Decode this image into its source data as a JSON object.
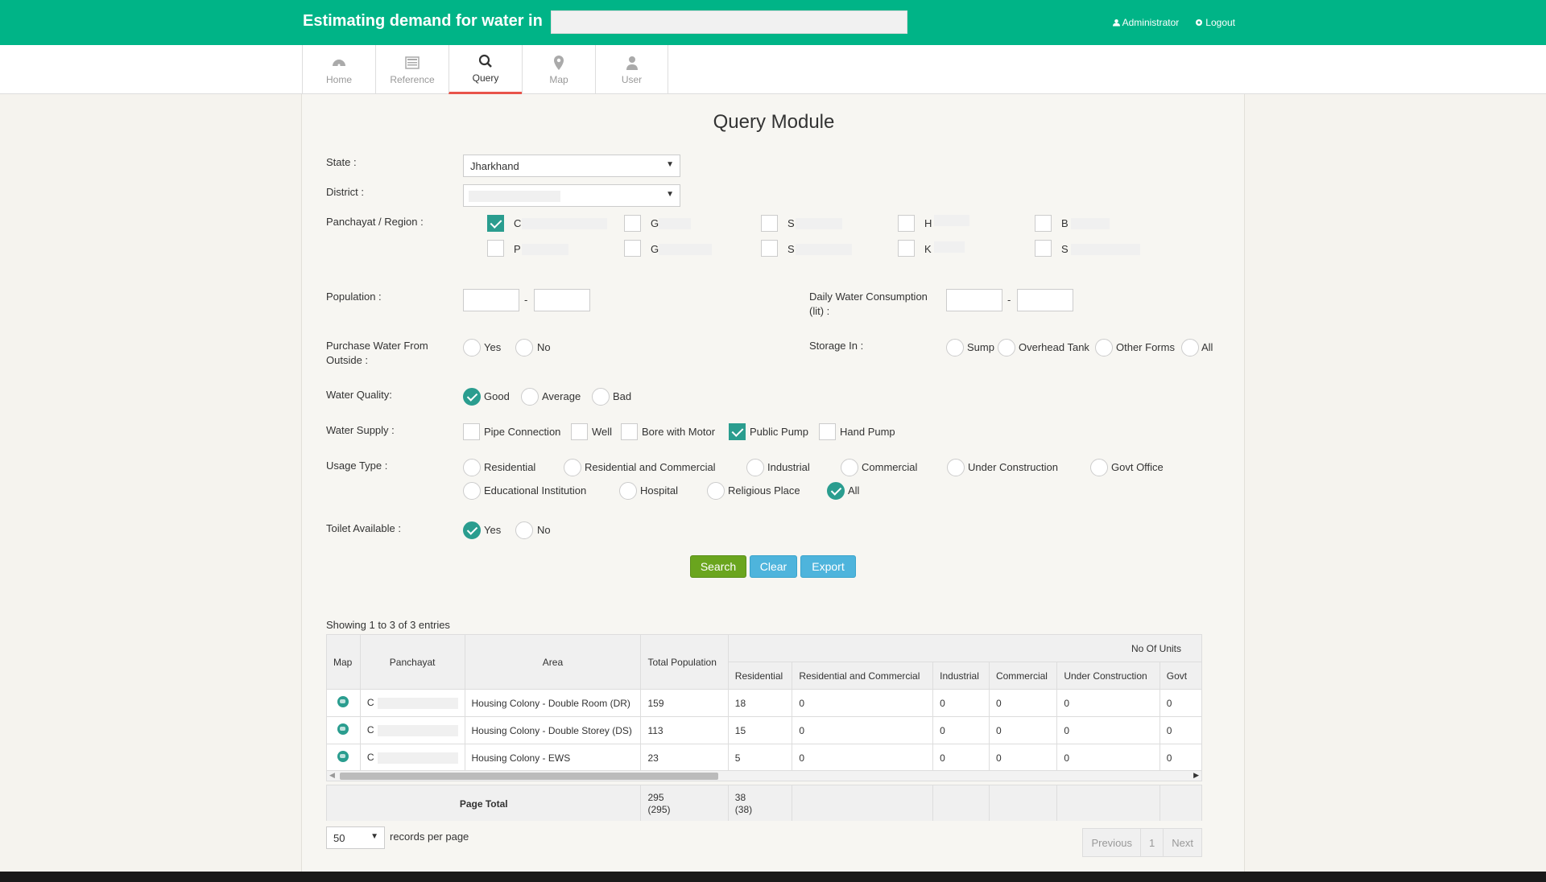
{
  "header": {
    "title": "Estimating demand for water in",
    "admin_label": "Administrator",
    "logout_label": "Logout"
  },
  "nav": {
    "tabs": [
      {
        "label": "Home",
        "icon": "dashboard-icon"
      },
      {
        "label": "Reference",
        "icon": "reference-icon"
      },
      {
        "label": "Query",
        "icon": "search-icon",
        "active": true
      },
      {
        "label": "Map",
        "icon": "map-pin-icon"
      },
      {
        "label": "User",
        "icon": "user-icon"
      }
    ]
  },
  "page_title": "Query Module",
  "form": {
    "state_label": "State :",
    "state_value": "Jharkhand",
    "district_label": "District :",
    "panchayat_label": "Panchayat / Region :",
    "panchayats": [
      {
        "initial": "C",
        "checked": true
      },
      {
        "initial": "G",
        "checked": false
      },
      {
        "initial": "S",
        "checked": false
      },
      {
        "initial": "H",
        "checked": false
      },
      {
        "initial": "B",
        "checked": false
      },
      {
        "initial": "P",
        "checked": false
      },
      {
        "initial": "G",
        "checked": false
      },
      {
        "initial": "S",
        "checked": false
      },
      {
        "initial": "K",
        "checked": false
      },
      {
        "initial": "S",
        "checked": false
      }
    ],
    "population_label": "Population :",
    "daily_label_1": "Daily Water Consumption",
    "daily_label_2": "(lit) :",
    "dash": "-",
    "purchase_label_1": "Purchase Water From",
    "purchase_label_2": "Outside :",
    "purchase_options": [
      {
        "label": "Yes",
        "checked": false
      },
      {
        "label": "No",
        "checked": false
      }
    ],
    "storage_label": "Storage In :",
    "storage_options": [
      {
        "label": "Sump"
      },
      {
        "label": "Overhead Tank"
      },
      {
        "label": "Other Forms"
      },
      {
        "label": "All"
      }
    ],
    "quality_label": "Water Quality:",
    "quality_options": [
      {
        "label": "Good",
        "checked": true
      },
      {
        "label": "Average",
        "checked": false
      },
      {
        "label": "Bad",
        "checked": false
      }
    ],
    "supply_label": "Water Supply :",
    "supply_options": [
      {
        "label": "Pipe Connection",
        "checked": false
      },
      {
        "label": "Well",
        "checked": false
      },
      {
        "label": "Bore with Motor",
        "checked": false
      },
      {
        "label": "Public Pump",
        "checked": true
      },
      {
        "label": "Hand Pump",
        "checked": false
      }
    ],
    "usage_label": "Usage Type :",
    "usage_options": [
      {
        "label": "Residential",
        "checked": false
      },
      {
        "label": "Residential and Commercial",
        "checked": false
      },
      {
        "label": "Industrial",
        "checked": false
      },
      {
        "label": "Commercial",
        "checked": false
      },
      {
        "label": "Under Construction",
        "checked": false
      },
      {
        "label": "Govt Office",
        "checked": false
      },
      {
        "label": "Educational Institution",
        "checked": false
      },
      {
        "label": "Hospital",
        "checked": false
      },
      {
        "label": "Religious Place",
        "checked": false
      },
      {
        "label": "All",
        "checked": true
      }
    ],
    "toilet_label": "Toilet Available :",
    "toilet_options": [
      {
        "label": "Yes",
        "checked": true
      },
      {
        "label": "No",
        "checked": false
      }
    ]
  },
  "buttons": {
    "search": "Search",
    "clear": "Clear",
    "export": "Export"
  },
  "table": {
    "info": "Showing 1 to 3 of 3 entries",
    "group_header": "No Of Units",
    "headers": [
      "Map",
      "Panchayat",
      "Area",
      "Total Population",
      "Residential",
      "Residential and Commercial",
      "Industrial",
      "Commercial",
      "Under Construction",
      "Govt"
    ],
    "rows": [
      {
        "panchayat": "C",
        "area": "Housing Colony - Double Room (DR)",
        "pop": "159",
        "res": "18",
        "rc": "0",
        "ind": "0",
        "com": "0",
        "uc": "0",
        "govt": "0"
      },
      {
        "panchayat": "C",
        "area": "Housing Colony - Double Storey (DS)",
        "pop": "113",
        "res": "15",
        "rc": "0",
        "ind": "0",
        "com": "0",
        "uc": "0",
        "govt": "0"
      },
      {
        "panchayat": "C",
        "area": "Housing Colony - EWS",
        "pop": "23",
        "res": "5",
        "rc": "0",
        "ind": "0",
        "com": "0",
        "uc": "0",
        "govt": "0"
      }
    ],
    "footer_label": "Page Total",
    "footer_pop_1": "295",
    "footer_pop_2": "(295)",
    "footer_res_1": "38",
    "footer_res_2": "(38)"
  },
  "pagination": {
    "per_page_value": "50",
    "per_page_label": "records per page",
    "previous": "Previous",
    "page": "1",
    "next": "Next"
  }
}
